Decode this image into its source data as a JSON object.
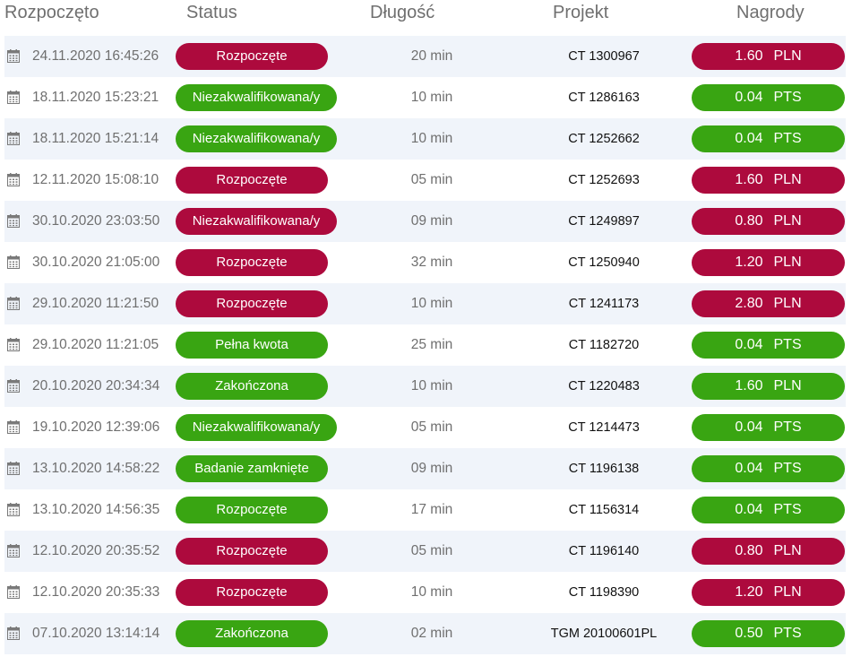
{
  "headers": {
    "started": "Rozpoczęto",
    "status": "Status",
    "length": "Długość",
    "project": "Projekt",
    "rewards": "Nagrody"
  },
  "colors": {
    "red": "#ad0a3d",
    "green": "#39a512"
  },
  "icons": {
    "date": "calendar-icon"
  },
  "rows": [
    {
      "date": "24.11.2020 16:45:26",
      "status": "Rozpoczęte",
      "status_color": "red",
      "length": "20 min",
      "project": "CT 1300967",
      "amount": "1.60",
      "currency": "PLN",
      "reward_color": "red"
    },
    {
      "date": "18.11.2020 15:23:21",
      "status": "Niezakwalifikowana/y",
      "status_color": "green",
      "length": "10 min",
      "project": "CT 1286163",
      "amount": "0.04",
      "currency": "PTS",
      "reward_color": "green"
    },
    {
      "date": "18.11.2020 15:21:14",
      "status": "Niezakwalifikowana/y",
      "status_color": "green",
      "length": "10 min",
      "project": "CT 1252662",
      "amount": "0.04",
      "currency": "PTS",
      "reward_color": "green"
    },
    {
      "date": "12.11.2020 15:08:10",
      "status": "Rozpoczęte",
      "status_color": "red",
      "length": "05 min",
      "project": "CT 1252693",
      "amount": "1.60",
      "currency": "PLN",
      "reward_color": "red"
    },
    {
      "date": "30.10.2020 23:03:50",
      "status": "Niezakwalifikowana/y",
      "status_color": "red",
      "length": "09 min",
      "project": "CT 1249897",
      "amount": "0.80",
      "currency": "PLN",
      "reward_color": "red"
    },
    {
      "date": "30.10.2020 21:05:00",
      "status": "Rozpoczęte",
      "status_color": "red",
      "length": "32 min",
      "project": "CT 1250940",
      "amount": "1.20",
      "currency": "PLN",
      "reward_color": "red"
    },
    {
      "date": "29.10.2020 11:21:50",
      "status": "Rozpoczęte",
      "status_color": "red",
      "length": "10 min",
      "project": "CT 1241173",
      "amount": "2.80",
      "currency": "PLN",
      "reward_color": "red"
    },
    {
      "date": "29.10.2020 11:21:05",
      "status": "Pełna kwota",
      "status_color": "green",
      "length": "25 min",
      "project": "CT 1182720",
      "amount": "0.04",
      "currency": "PTS",
      "reward_color": "green"
    },
    {
      "date": "20.10.2020 20:34:34",
      "status": "Zakończona",
      "status_color": "green",
      "length": "10 min",
      "project": "CT 1220483",
      "amount": "1.60",
      "currency": "PLN",
      "reward_color": "green"
    },
    {
      "date": "19.10.2020 12:39:06",
      "status": "Niezakwalifikowana/y",
      "status_color": "green",
      "length": "05 min",
      "project": "CT 1214473",
      "amount": "0.04",
      "currency": "PTS",
      "reward_color": "green"
    },
    {
      "date": "13.10.2020 14:58:22",
      "status": "Badanie zamknięte",
      "status_color": "green",
      "length": "09 min",
      "project": "CT 1196138",
      "amount": "0.04",
      "currency": "PTS",
      "reward_color": "green"
    },
    {
      "date": "13.10.2020 14:56:35",
      "status": "Rozpoczęte",
      "status_color": "green",
      "length": "17 min",
      "project": "CT 1156314",
      "amount": "0.04",
      "currency": "PTS",
      "reward_color": "green"
    },
    {
      "date": "12.10.2020 20:35:52",
      "status": "Rozpoczęte",
      "status_color": "red",
      "length": "05 min",
      "project": "CT 1196140",
      "amount": "0.80",
      "currency": "PLN",
      "reward_color": "red"
    },
    {
      "date": "12.10.2020 20:35:33",
      "status": "Rozpoczęte",
      "status_color": "red",
      "length": "10 min",
      "project": "CT 1198390",
      "amount": "1.20",
      "currency": "PLN",
      "reward_color": "red"
    },
    {
      "date": "07.10.2020 13:14:14",
      "status": "Zakończona",
      "status_color": "green",
      "length": "02 min",
      "project": "TGM 20100601PL",
      "amount": "0.50",
      "currency": "PTS",
      "reward_color": "green"
    }
  ]
}
